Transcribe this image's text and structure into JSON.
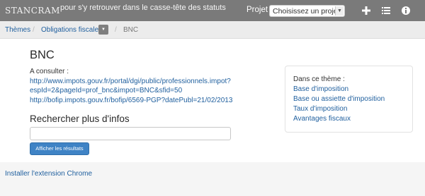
{
  "header": {
    "logo_text": "STANCRAM",
    "tagline": "pour s'y retrouver dans le casse-tête des statuts",
    "projet_label": "Projet :",
    "projet_select_value": "Choisissez un projet",
    "icons": [
      "plus-icon",
      "list-icon",
      "info-icon"
    ]
  },
  "breadcrumb": {
    "items": [
      "Thèmes",
      "Obligations fiscales"
    ],
    "current": "BNC"
  },
  "main": {
    "title": "BNC",
    "consult_label": "A consulter :",
    "urls": [
      "http://www.impots.gouv.fr/portal/dgi/public/professionnels.impot?",
      "espId=2&pageId=prof_bnc&impot=BNC&sfid=50",
      "http://bofip.impots.gouv.fr/bofip/6569-PGP?datePubl=21/02/2013"
    ],
    "search_title": "Rechercher plus d'infos",
    "search_value": "",
    "search_button": "Afficher les résultats"
  },
  "theme_box": {
    "title": "Dans ce thème :",
    "links": [
      "Base d'imposition",
      "Base ou assiette d'imposition",
      "Taux d'imposition",
      "Avantages fiscaux"
    ]
  },
  "footer": {
    "link": "Installer l'extension Chrome"
  },
  "colors": {
    "topbar": "#7a7a7a",
    "link": "#1f5f9e",
    "button": "#3f83c5"
  }
}
